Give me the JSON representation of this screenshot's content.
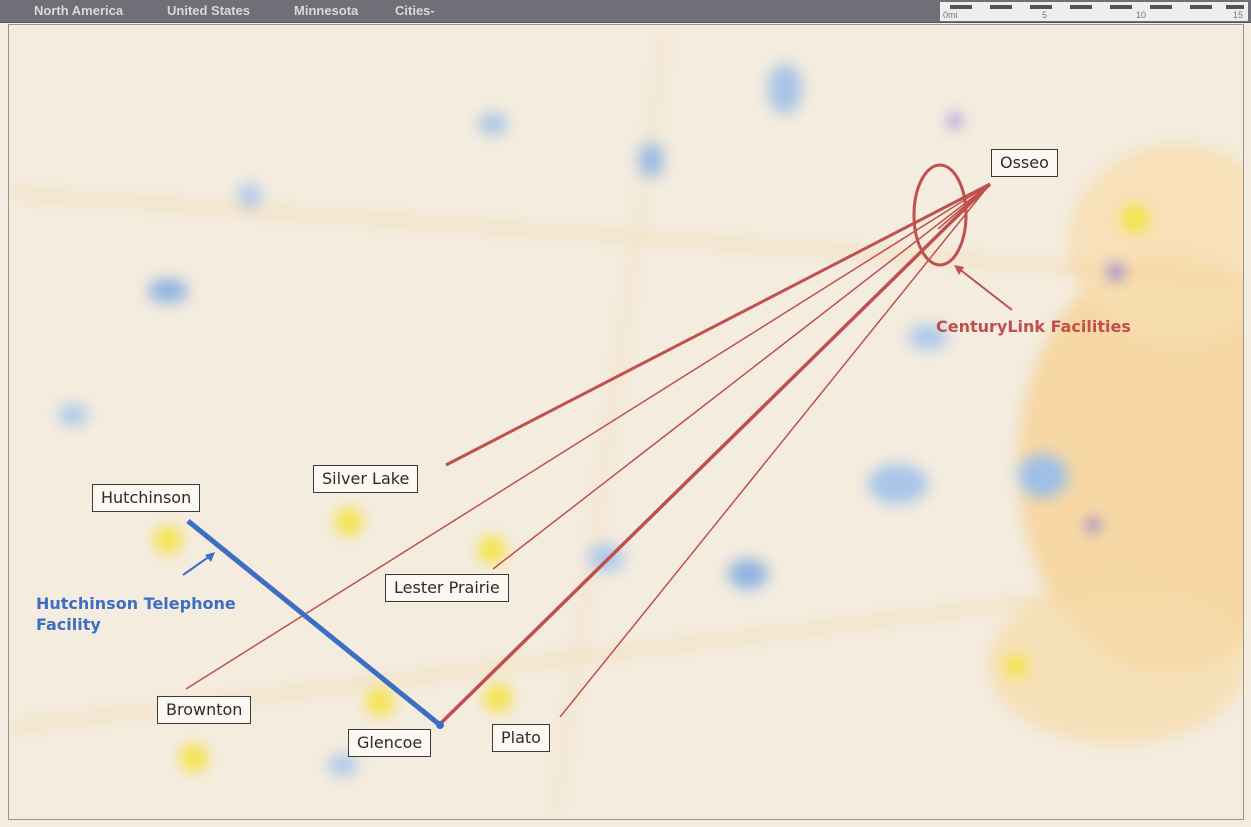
{
  "breadcrumb": {
    "items": [
      "North America",
      "United States",
      "Minnesota",
      "Cities-"
    ]
  },
  "scale_bar": {
    "unit": "mi",
    "ticks": [
      "0",
      "5",
      "10",
      "15"
    ]
  },
  "colors": {
    "centurylink": "#c0504d",
    "hutchinson_telephone": "#3c6fc4",
    "city_dot": "#f5e34a",
    "water": "#8fb4e0",
    "metro": "#f4c878"
  },
  "places": {
    "osseo": "Osseo",
    "silver_lake": "Silver Lake",
    "hutchinson": "Hutchinson",
    "lester_prairie": "Lester Prairie",
    "brownton": "Brownton",
    "glencoe": "Glencoe",
    "plato": "Plato"
  },
  "callouts": {
    "centurylink": "CenturyLink Facilities",
    "hutchinson_line1": "Hutchinson Telephone",
    "hutchinson_line2": "Facility"
  },
  "connections": {
    "centurylink": [
      {
        "from": "Osseo",
        "to": "Silver Lake"
      },
      {
        "from": "Osseo",
        "to": "Brownton"
      },
      {
        "from": "Osseo",
        "to": "Lester Prairie"
      },
      {
        "from": "Osseo",
        "to": "Glencoe"
      },
      {
        "from": "Osseo",
        "to": "Plato"
      }
    ],
    "hutchinson_telephone": [
      {
        "from": "Hutchinson",
        "to": "Glencoe"
      }
    ]
  }
}
